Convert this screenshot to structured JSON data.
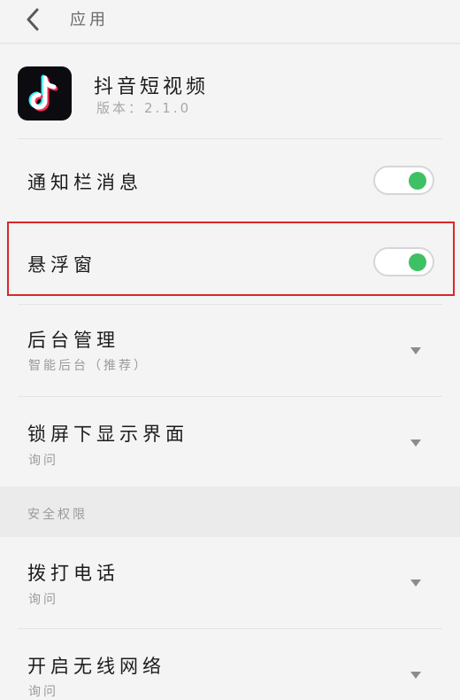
{
  "header": {
    "title": "应用"
  },
  "app": {
    "name": "抖音短视频",
    "version": "版本：2.1.0"
  },
  "toggles": {
    "notification": {
      "label": "通知栏消息",
      "state": "on"
    },
    "floating_window": {
      "label": "悬浮窗",
      "state": "on"
    }
  },
  "settings": {
    "background": {
      "label": "后台管理",
      "value": "智能后台（推荐）"
    },
    "lockscreen": {
      "label": "锁屏下显示界面",
      "value": "询问"
    }
  },
  "security_section": {
    "title": "安全权限",
    "items": [
      {
        "label": "拨打电话",
        "value": "询问"
      },
      {
        "label": "开启无线网络",
        "value": "询问"
      }
    ]
  },
  "colors": {
    "toggle_on": "#3ec163",
    "highlight": "#d9262c"
  }
}
